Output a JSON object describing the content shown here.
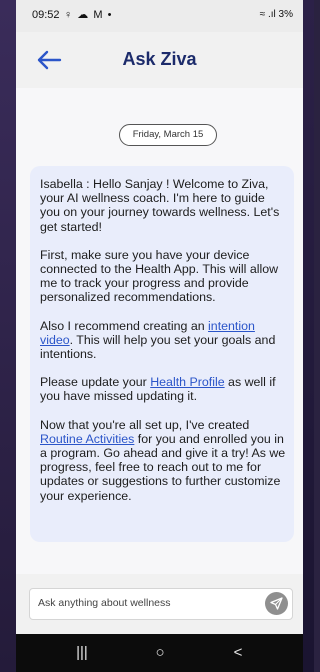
{
  "status_bar": {
    "time": "09:52",
    "left_icons": "♀ ☁ M •",
    "right_icons": "≈ .ıl 3%"
  },
  "header": {
    "title": "Ask Ziva"
  },
  "chat": {
    "date": "Friday, March 15",
    "message": {
      "p1": "Isabella : Hello Sanjay ! Welcome to Ziva, your AI wellness coach. I'm here to guide you on your journey towards wellness. Let's get started!",
      "p2": "First, make sure you have your device connected to the Health App. This will allow me to track your progress and provide personalized recommendations.",
      "p3_before": "Also I recommend creating an ",
      "p3_link": "intention video",
      "p3_after": ". This will help you set your goals and intentions.",
      "p4_before": "Please update your ",
      "p4_link": "Health Profile",
      "p4_after": " as well if you have missed updating it.",
      "p5_before": "Now that you're all set up, I've created ",
      "p5_link": "Routine Activities",
      "p5_after": " for you and enrolled you in a program. Go ahead and give it a try! As we progress, feel free to reach out to me for updates or suggestions to further customize your experience."
    }
  },
  "composer": {
    "placeholder": "Ask anything about wellness"
  },
  "nav": {
    "recents": "|||",
    "home": "○",
    "back": "<"
  },
  "colors": {
    "title": "#1c2b6b",
    "accent": "#2b55c9",
    "bubble": "#e9edfb"
  }
}
